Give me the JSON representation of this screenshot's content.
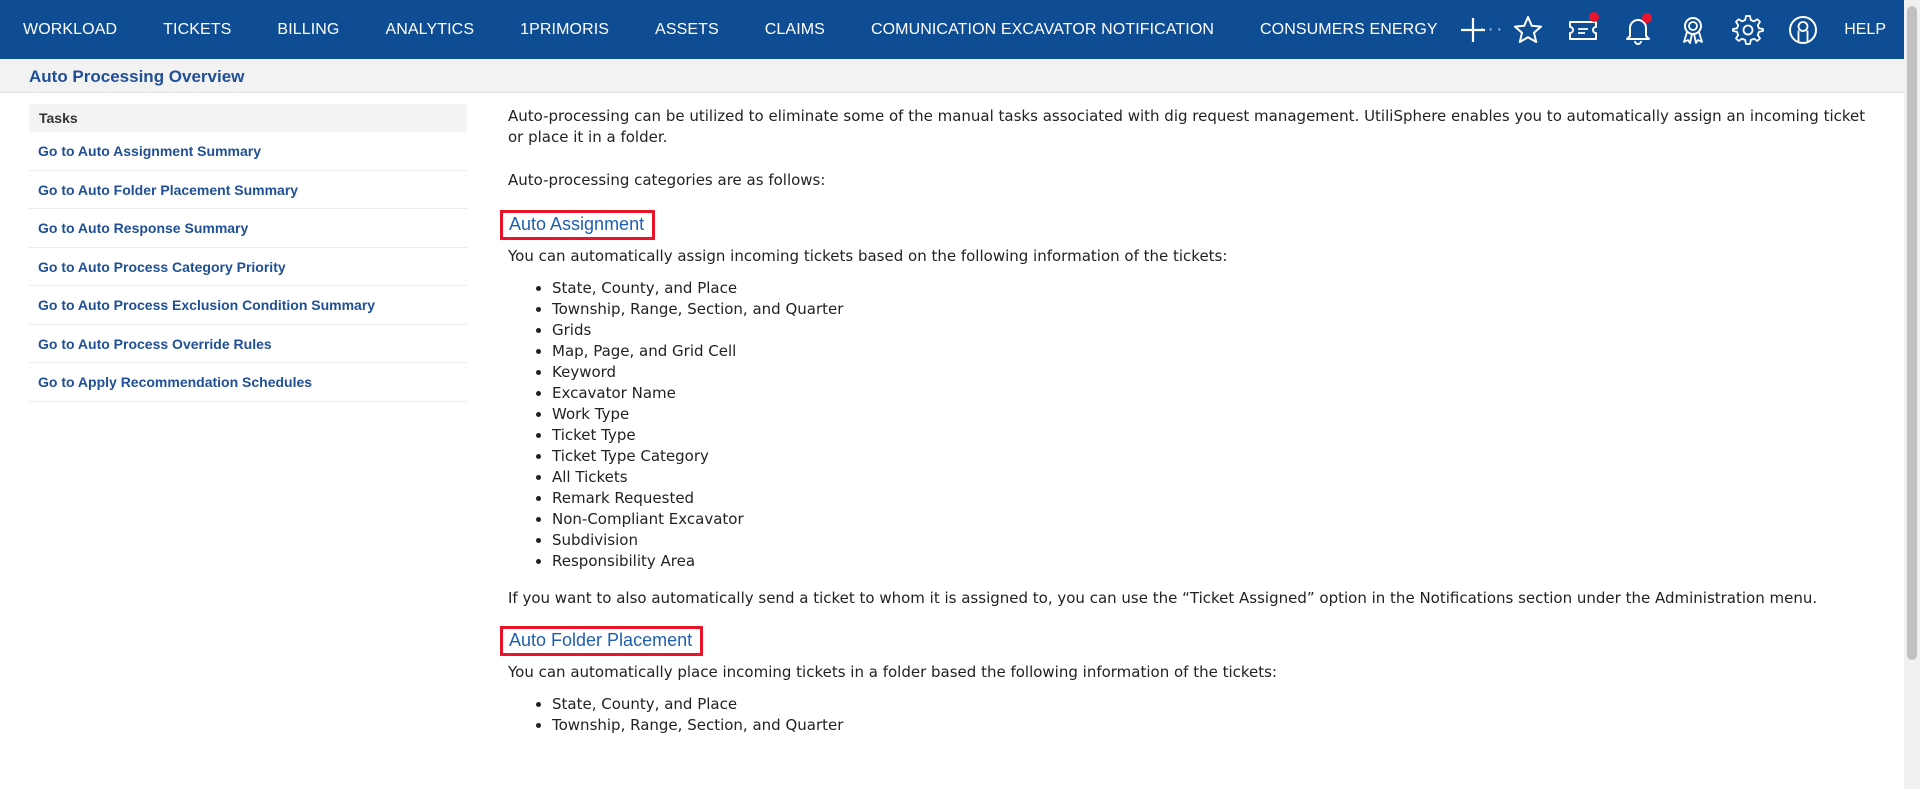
{
  "nav": {
    "items": [
      "WORKLOAD",
      "TICKETS",
      "BILLING",
      "ANALYTICS",
      "1PRIMORIS",
      "ASSETS",
      "CLAIMS",
      "COMUNICATION EXCAVATOR NOTIFICATION",
      "CONSUMERS ENERGY"
    ],
    "more": "···",
    "help": "HELP",
    "icons": [
      "plus-icon",
      "star-icon",
      "ticket-icon",
      "bell-icon",
      "award-icon",
      "gear-icon",
      "user-icon"
    ],
    "colors": {
      "background": "#0e4d94",
      "notification": "#e8142b"
    }
  },
  "header": {
    "title": "Auto Processing Overview"
  },
  "sidebar": {
    "heading": "Tasks",
    "links": [
      "Go to Auto Assignment Summary",
      "Go to Auto Folder Placement Summary",
      "Go to Auto Response Summary",
      "Go to Auto Process Category Priority",
      "Go to Auto Process Exclusion Condition Summary",
      "Go to Auto Process Override Rules",
      "Go to Apply Recommendation Schedules"
    ]
  },
  "content": {
    "intro": "Auto-processing can be utilized to eliminate some of the manual tasks associated with dig request management. UtiliSphere enables you to automatically assign an incoming ticket or place it in a folder.",
    "categories_intro": "Auto-processing categories are as follows:",
    "auto_assignment": {
      "heading": "Auto Assignment",
      "description": "You can automatically assign incoming tickets based on the following information of the tickets:",
      "items": [
        "State, County, and Place",
        "Township, Range, Section, and Quarter",
        "Grids",
        "Map, Page, and Grid Cell",
        "Keyword",
        "Excavator Name",
        "Work Type",
        "Ticket Type",
        "Ticket Type Category",
        "All Tickets",
        "Remark Requested",
        "Non-Compliant Excavator",
        "Subdivision",
        "Responsibility Area"
      ],
      "note": "If you want to also automatically send a ticket to whom it is assigned to, you can use the “Ticket Assigned” option in the Notifications section under the Administration menu."
    },
    "auto_folder_placement": {
      "heading": "Auto Folder Placement",
      "description": "You can automatically place incoming tickets in a folder based the following information of the tickets:",
      "items": [
        "State, County, and Place",
        "Township, Range, Section, and Quarter"
      ]
    },
    "colors": {
      "highlight_border": "#e8142b",
      "link": "#1f5fb0"
    }
  }
}
